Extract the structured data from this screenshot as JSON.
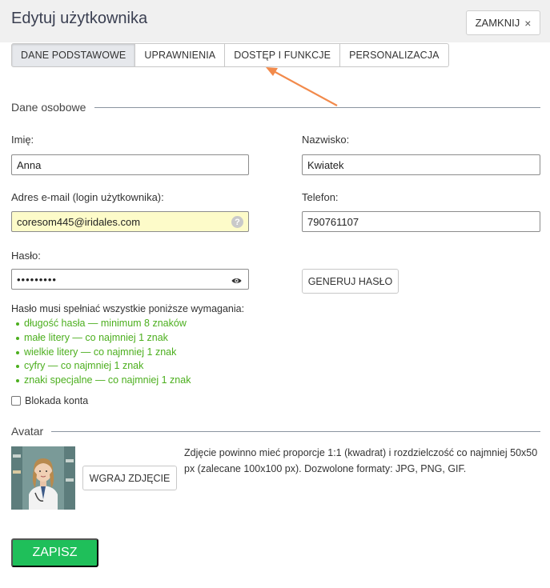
{
  "header": {
    "title": "Edytuj użytkownika",
    "close_label": "ZAMKNIJ",
    "close_icon": "×"
  },
  "tabs": [
    {
      "label": "DANE PODSTAWOWE",
      "active": true
    },
    {
      "label": "UPRAWNIENIA",
      "active": false
    },
    {
      "label": "DOSTĘP I FUNKCJE",
      "active": false
    },
    {
      "label": "PERSONALIZACJA",
      "active": false
    }
  ],
  "personal": {
    "section_title": "Dane osobowe",
    "first_name_label": "Imię:",
    "first_name_value": "Anna",
    "last_name_label": "Nazwisko:",
    "last_name_value": "Kwiatek",
    "email_label": "Adres e-mail (login użytkownika):",
    "email_value": "coresom445@iridales.com",
    "phone_label": "Telefon:",
    "phone_value": "790761107",
    "password_label": "Hasło:",
    "password_value": "•••••••••",
    "generate_label": "GENERUJ HASŁO",
    "requirements_title": "Hasło musi spełniać wszystkie poniższe wymagania:",
    "requirements": [
      "długość hasła — minimum 8 znaków",
      "małe litery — co najmniej 1 znak",
      "wielkie litery — co najmniej 1 znak",
      "cyfry — co najmniej 1 znak",
      "znaki specjalne — co najmniej 1 znak"
    ],
    "lock_label": "Blokada konta"
  },
  "avatar": {
    "section_title": "Avatar",
    "upload_label": "WGRAJ ZDJĘCIE",
    "note": "Zdjęcie powinno mieć proporcje 1:1 (kwadrat) i rozdzielczość co najmniej 50x50 px (zalecane 100x100 px). Dozwolone formaty: JPG, PNG, GIF."
  },
  "save_label": "ZAPISZ",
  "colors": {
    "accent_green": "#1fbf5a",
    "requirement_green": "#4caf1e",
    "autofill_yellow": "#fdfbc9",
    "arrow_orange": "#f28a4b"
  }
}
